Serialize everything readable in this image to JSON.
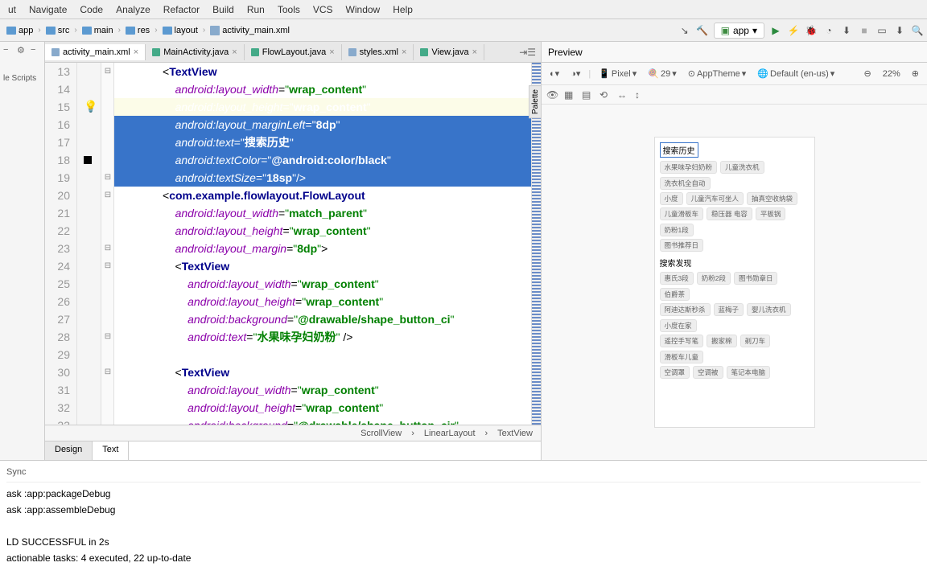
{
  "menu": [
    "ut",
    "Navigate",
    "Code",
    "Analyze",
    "Refactor",
    "Build",
    "Run",
    "Tools",
    "VCS",
    "Window",
    "Help"
  ],
  "breadcrumbs": [
    "app",
    "src",
    "main",
    "res",
    "layout",
    "activity_main.xml"
  ],
  "run_config": "app",
  "left_panel_label": "le Scripts",
  "tabs": [
    {
      "name": "activity_main.xml",
      "icon_color": "#8ac",
      "active": true
    },
    {
      "name": "MainActivity.java",
      "icon_color": "#4a8",
      "active": false
    },
    {
      "name": "FlowLayout.java",
      "icon_color": "#4a8",
      "active": false
    },
    {
      "name": "styles.xml",
      "icon_color": "#8ac",
      "active": false
    },
    {
      "name": "View.java",
      "icon_color": "#4a8",
      "active": false
    }
  ],
  "code_lines": [
    {
      "n": 13,
      "text": "TextView",
      "type": "tag_open"
    },
    {
      "n": 14,
      "attr": "android:layout_width",
      "val": "wrap_content"
    },
    {
      "n": 15,
      "attr": "android:layout_height",
      "val": "wrap_content",
      "selected": true,
      "hl": true
    },
    {
      "n": 16,
      "attr": "android:layout_marginLeft",
      "val": "8dp",
      "selected": true
    },
    {
      "n": 17,
      "attr": "android:text",
      "val": "搜索历史",
      "selected": true
    },
    {
      "n": 18,
      "attr": "android:textColor",
      "val": "@android:color/black",
      "selected": true,
      "bp": true
    },
    {
      "n": 19,
      "attr": "android:textSize",
      "val": "18sp",
      "close": "/>",
      "selected": true
    },
    {
      "n": 20,
      "text": "com.example.flowlayout.FlowLayout",
      "type": "tag_open"
    },
    {
      "n": 21,
      "attr": "android:layout_width",
      "val": "match_parent"
    },
    {
      "n": 22,
      "attr": "android:layout_height",
      "val": "wrap_content"
    },
    {
      "n": 23,
      "attr": "android:layout_margin",
      "val": "8dp",
      "close": ">"
    },
    {
      "n": 24,
      "text": "TextView",
      "type": "tag_open",
      "indent": 1
    },
    {
      "n": 25,
      "attr": "android:layout_width",
      "val": "wrap_content",
      "indent": 1
    },
    {
      "n": 26,
      "attr": "android:layout_height",
      "val": "wrap_content",
      "indent": 1
    },
    {
      "n": 27,
      "attr": "android:background",
      "val": "@drawable/shape_button_ci",
      "indent": 1
    },
    {
      "n": 28,
      "attr": "android:text",
      "val": "水果味孕妇奶粉",
      "close": " />",
      "indent": 1
    },
    {
      "n": 29,
      "blank": true
    },
    {
      "n": 30,
      "text": "TextView",
      "type": "tag_open",
      "indent": 1
    },
    {
      "n": 31,
      "attr": "android:layout_width",
      "val": "wrap_content",
      "indent": 1
    },
    {
      "n": 32,
      "attr": "android:layout_height",
      "val": "wrap_content",
      "indent": 1
    },
    {
      "n": 33,
      "attr": "android:background",
      "val": "@drawable/shape_button_cir",
      "indent": 1
    }
  ],
  "bottom_crumbs": [
    "ScrollView",
    "LinearLayout",
    "TextView"
  ],
  "design_tabs": [
    "Design",
    "Text"
  ],
  "preview": {
    "title": "Preview",
    "toolbar": {
      "device": "Pixel",
      "api": "29",
      "theme": "AppTheme",
      "locale": "Default (en-us)",
      "zoom": "22%"
    },
    "section1": "搜索历史",
    "chips1": [
      [
        "水果味孕妇奶粉",
        "儿童洗衣机",
        "洗衣机全自动"
      ],
      [
        "小度",
        "儿童汽车可坐人",
        "抽真空收纳袋"
      ],
      [
        "儿童滑板车",
        "稳压器 电容",
        "平板锅",
        "奶粉1段"
      ],
      [
        "图书推荐日"
      ]
    ],
    "section2": "搜索发现",
    "chips2": [
      [
        "惠氏3段",
        "奶粉2段",
        "图书勋章日",
        "伯爵茶"
      ],
      [
        "阿迪达斯秒杀",
        "蓝梅子",
        "婴儿洗衣机",
        "小度在家"
      ],
      [
        "遥控手写笔",
        "搬家棉",
        "剃刀车",
        "滑板车儿童"
      ],
      [
        "空调罩",
        "空调被",
        "笔记本电脑"
      ]
    ]
  },
  "build": {
    "title": "Sync",
    "lines": [
      "ask :app:packageDebug",
      "ask :app:assembleDebug",
      "",
      "LD SUCCESSFUL in 2s",
      "actionable tasks: 4 executed, 22 up-to-date"
    ]
  },
  "palette_label": "Palette"
}
